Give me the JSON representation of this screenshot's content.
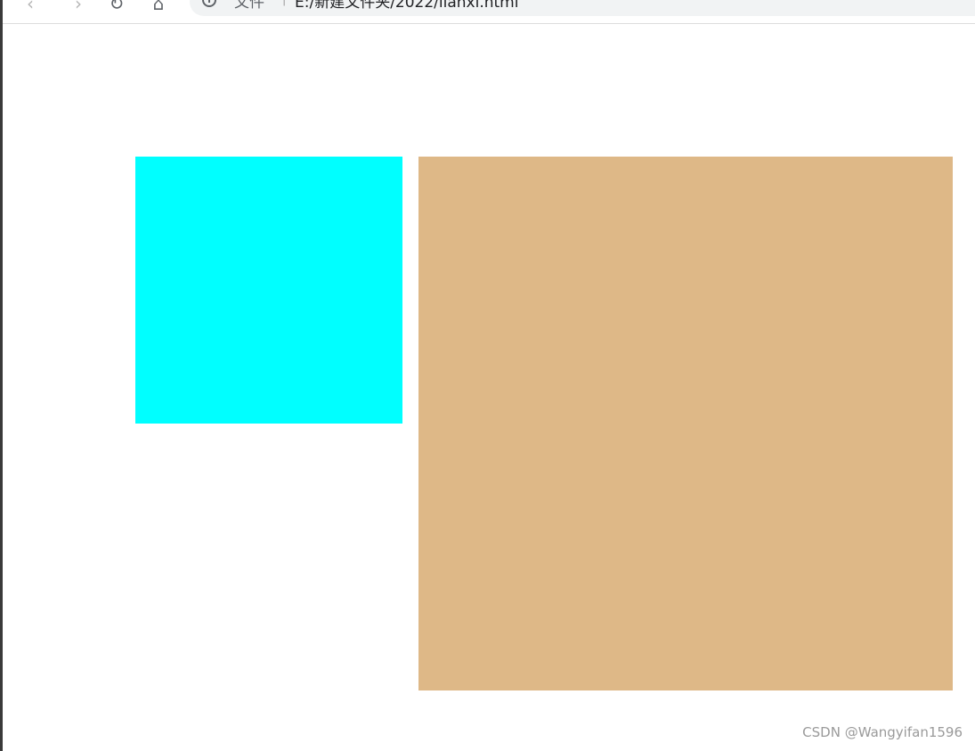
{
  "toolbar": {
    "back_icon": "chevron-left-icon",
    "forward_icon": "chevron-right-icon",
    "reload_icon": "reload-icon",
    "home_icon": "home-icon",
    "address": {
      "scheme_label": "文件",
      "separator": "|",
      "url": "E:/新建文件夹/2022/lianxi.html"
    }
  },
  "page": {
    "boxes": [
      {
        "name": "cyan-box",
        "color": "#00ffff"
      },
      {
        "name": "tan-box",
        "color": "#deb887"
      }
    ]
  },
  "watermark": {
    "text": "CSDN @Wangyifan1596"
  }
}
